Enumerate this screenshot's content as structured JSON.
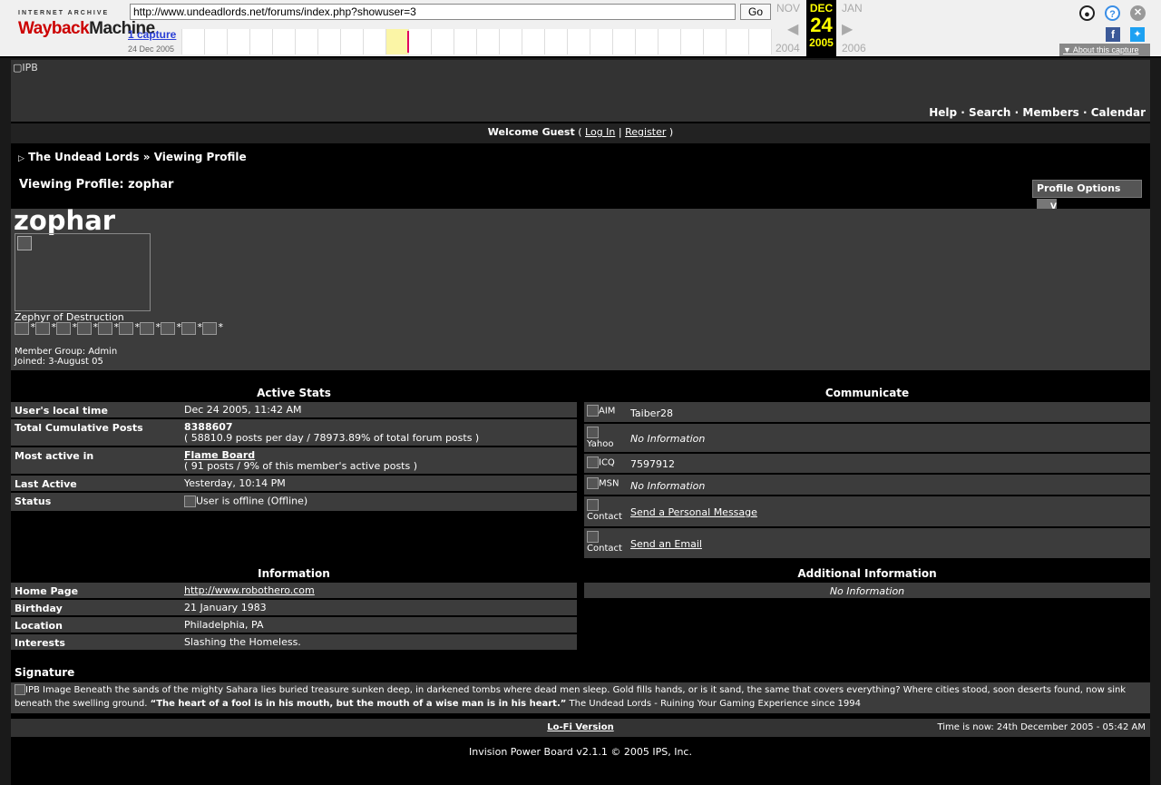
{
  "wayback": {
    "ia_label": "INTERNET ARCHIVE",
    "logo_part1": "Wayback",
    "logo_part2": "Machine",
    "url": "http://www.undeadlords.net/forums/index.php?showuser=3",
    "go_label": "Go",
    "captures_link": "1 capture",
    "capture_date": "24 Dec 2005",
    "prev_month": "NOV",
    "cur_month": "DEC",
    "next_month": "JAN",
    "prev_year": "2004",
    "cur_day": "24",
    "cur_year": "2005",
    "next_year": "2006",
    "about_label": "About this capture",
    "icons": [
      "user-icon",
      "help-icon",
      "close-icon",
      "facebook-icon",
      "twitter-icon"
    ]
  },
  "board": {
    "logo_alt": "IPB",
    "nav": [
      "Help",
      "Search",
      "Members",
      "Calendar"
    ],
    "nav_sep": " · ",
    "welcome_prefix": "Welcome Guest",
    "login_label": "Log In",
    "register_label": "Register",
    "crumb_home": "The Undead Lords",
    "crumb_sep": "»",
    "crumb_current": "Viewing Profile",
    "viewing_title": "Viewing Profile: zophar",
    "profile_options": "Profile Options",
    "options_img_alt": "V"
  },
  "profile": {
    "username": "zophar",
    "rank_title": "Zephyr of Destruction",
    "pip_count": 10,
    "member_group": "Member Group: Admin",
    "joined": "Joined: 3-August 05"
  },
  "active_stats": {
    "title": "Active Stats",
    "local_time_label": "User's local time",
    "local_time": "Dec 24 2005, 11:42 AM",
    "posts_label": "Total Cumulative Posts",
    "posts_total": "8388607",
    "posts_detail": "( 58810.9 posts per day / 78973.89% of total forum posts )",
    "most_active_label": "Most active in",
    "most_active_forum": "Flame Board",
    "most_active_detail": "( 91 posts / 9% of this member's active posts )",
    "last_active_label": "Last Active",
    "last_active": "Yesterday, 10:14 PM",
    "status_label": "Status",
    "status_value": "User is offline (Offline)"
  },
  "communicate": {
    "title": "Communicate",
    "aim_label": "AIM",
    "aim_value": "Taiber28",
    "yahoo_label": "Yahoo",
    "yahoo_value": "No Information",
    "icq_label": "ICQ",
    "icq_value": "7597912",
    "msn_label": "MSN",
    "msn_value": "No Information",
    "contact_label": "Contact",
    "pm_link": "Send a Personal Message",
    "email_link": "Send an Email"
  },
  "information": {
    "title": "Information",
    "homepage_label": "Home Page",
    "homepage": "http://www.robothero.com",
    "birthday_label": "Birthday",
    "birthday": "21 January 1983",
    "location_label": "Location",
    "location": "Philadelphia, PA",
    "interests_label": "Interests",
    "interests": "Slashing the Homeless."
  },
  "additional": {
    "title": "Additional Information",
    "value": "No Information"
  },
  "signature": {
    "title": "Signature",
    "img_alt": "IPB Image",
    "text1": "Beneath the sands of the mighty Sahara lies buried treasure sunken deep, in darkened tombs where dead men sleep. Gold fills hands, or is it sand, the same that covers everything? Where cities stood, soon deserts found, now sink beneath the swelling ground.",
    "quote": "“The heart of a fool is in his mouth, but the mouth of a wise man is in his heart.”",
    "text2": "The Undead Lords - Ruining Your Gaming Experience since 1994"
  },
  "footer": {
    "lofi": "Lo-Fi Version",
    "time": "Time is now: 24th December 2005 - 05:42 AM",
    "copyright": "Invision Power Board v2.1.1 © 2005  IPS, Inc."
  }
}
